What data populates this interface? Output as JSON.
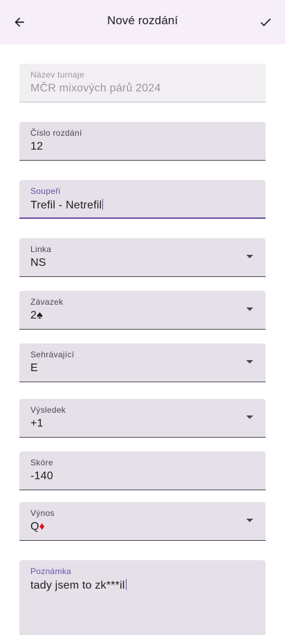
{
  "appbar": {
    "title": "Nové rozdání",
    "back_icon": "arrow-back-icon",
    "confirm_icon": "check-icon"
  },
  "form": {
    "tournament": {
      "label": "Název turnaje",
      "value": "MČR mixových párů 2024"
    },
    "deal_number": {
      "label": "Číslo rozdání",
      "value": "12"
    },
    "opponents": {
      "label": "Soupeři",
      "value": "Trefil - Netrefil"
    },
    "line": {
      "label": "Linka",
      "value": "NS"
    },
    "contract": {
      "label": "Závazek",
      "level": "2",
      "suit": "♠"
    },
    "declarer": {
      "label": "Sehrávající",
      "value": "E"
    },
    "result": {
      "label": "Výsledek",
      "value": "+1"
    },
    "score": {
      "label": "Skóre",
      "value": "-140"
    },
    "lead": {
      "label": "Výnos",
      "rank": "Q",
      "suit": "♦"
    },
    "note": {
      "label": "Poznámka",
      "value": "tady jsem to zk***il"
    }
  },
  "colors": {
    "appbar_bg": "#f6eef8",
    "field_bg": "#e6e0e9",
    "accent": "#6750a4",
    "diamond": "#e0101b"
  }
}
